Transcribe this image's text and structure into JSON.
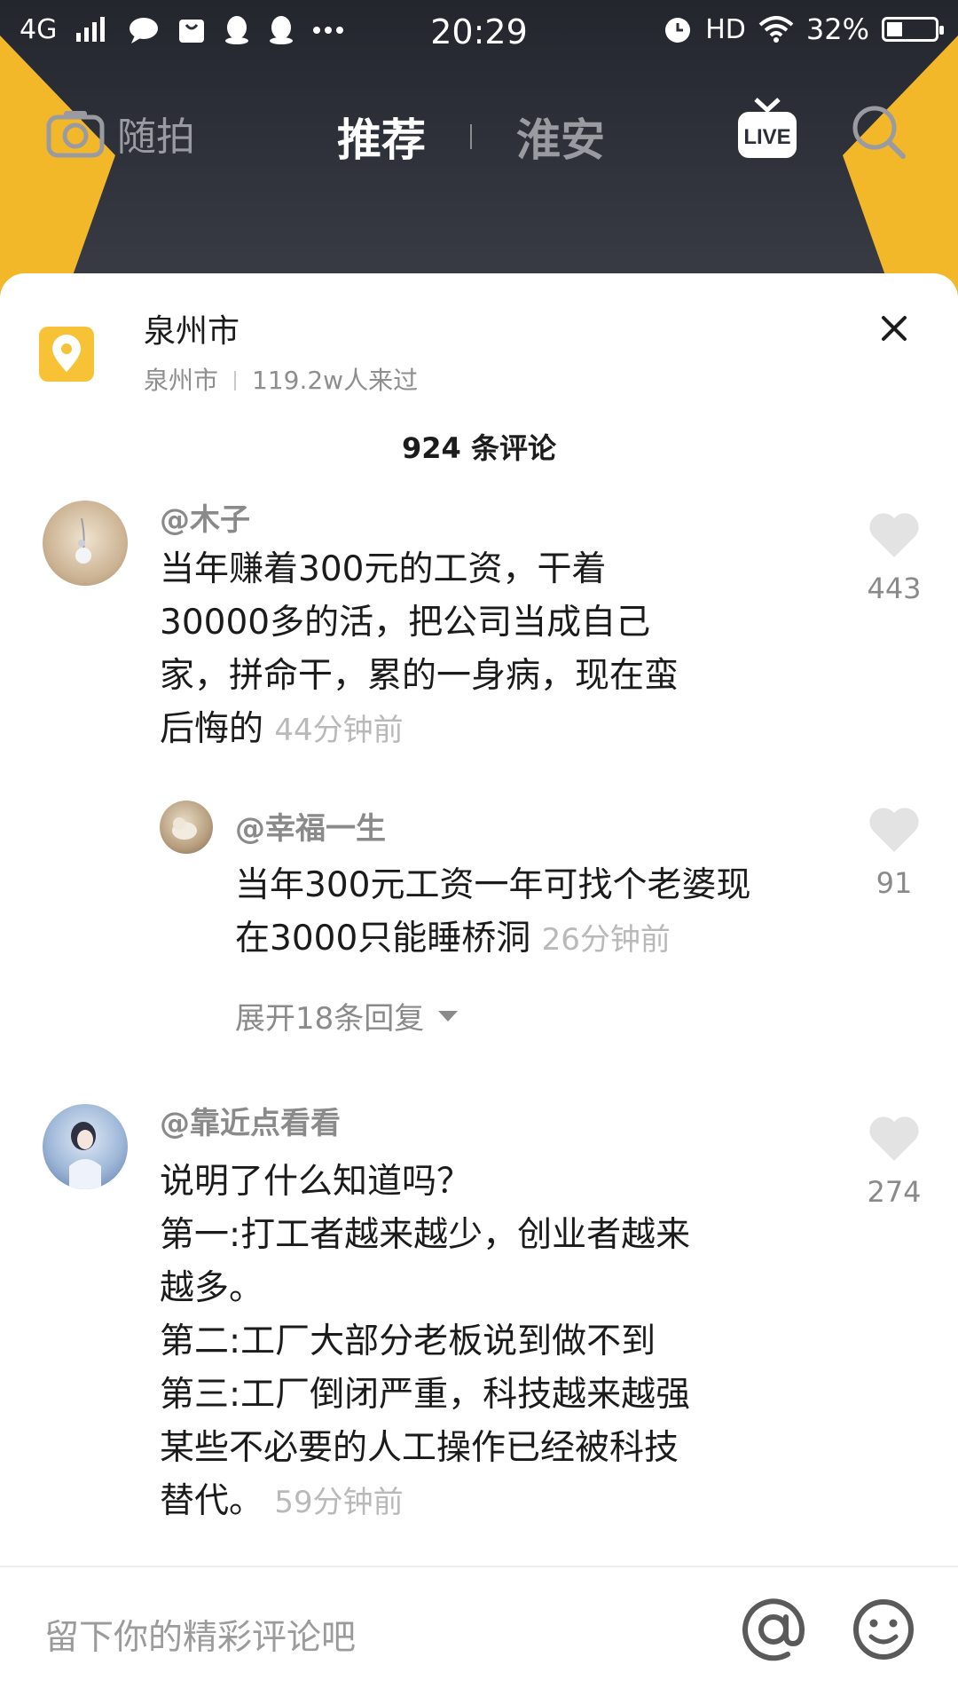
{
  "status_bar": {
    "network": "4G",
    "time": "20:29",
    "hd": "HD",
    "battery": "32%",
    "battery_level": 0.32
  },
  "nav": {
    "camera_label": "随拍",
    "tab_active": "推荐",
    "tab_city": "淮安",
    "live_label": "LIVE"
  },
  "location": {
    "title": "泉州市",
    "subtitle_city": "泉州市",
    "visitors": "119.2w人来过"
  },
  "comments_header": "924 条评论",
  "comments": [
    {
      "user": "@木子",
      "text": "当年赚着300元的工资，干着\n30000多的活，把公司当成自己\n家，拼命干，累的一身病，现在蛮\n后悔的",
      "time": "44分钟前",
      "likes": "443"
    },
    {
      "user": "@幸福一生",
      "text": "当年300元工资一年可找个老婆现\n在3000只能睡桥洞",
      "time": "26分钟前",
      "likes": "91"
    },
    {
      "user": "@靠近点看看",
      "text": "说明了什么知道吗？\n第一:打工者越来越少，创业者越来\n越多。\n第二:工厂大部分老板说到做不到\n第三:工厂倒闭严重，科技越来越强\n某些不必要的人工操作已经被科技\n替代。",
      "time": "59分钟前",
      "likes": "274"
    }
  ],
  "expand_replies": "展开18条回复",
  "input": {
    "placeholder": "留下你的精彩评论吧"
  },
  "colors": {
    "header_bg": "#2b2e36",
    "accent_yellow": "#f7c236",
    "text_primary": "#1b1b1b",
    "text_secondary": "#8a8a8a"
  }
}
